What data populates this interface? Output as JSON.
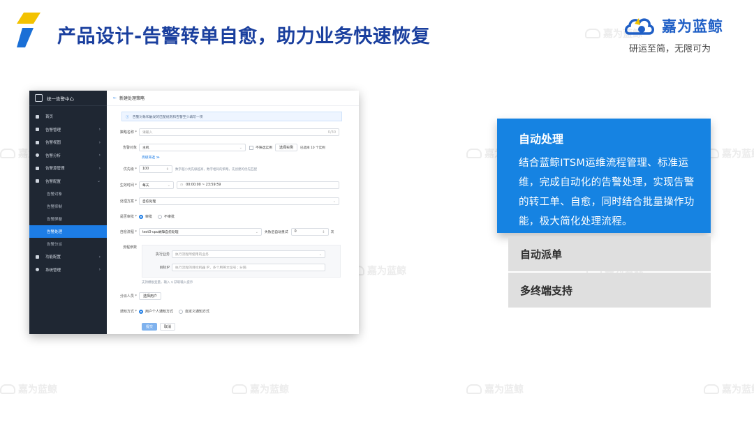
{
  "slide": {
    "title": "产品设计-告警转单自愈，助力业务快速恢复",
    "brand_name": "嘉为蓝鲸",
    "slogan": "研运至简，无限可为",
    "watermark": "嘉为蓝鲸"
  },
  "screenshot": {
    "sidebar": {
      "title": "统一告警中心",
      "items": [
        {
          "label": "首页",
          "arrow": ""
        },
        {
          "label": "告警管理",
          "arrow": "›"
        },
        {
          "label": "告警视图",
          "arrow": "›"
        },
        {
          "label": "告警分析",
          "arrow": "›"
        },
        {
          "label": "告警源管理",
          "arrow": "›"
        },
        {
          "label": "告警配置",
          "arrow": "⌄"
        }
      ],
      "subitems": [
        {
          "label": "告警对象"
        },
        {
          "label": "告警抑制"
        },
        {
          "label": "告警屏蔽"
        },
        {
          "label": "告警处理"
        },
        {
          "label": "告警分派"
        }
      ],
      "bottom_items": [
        {
          "label": "功能配置",
          "arrow": "›"
        },
        {
          "label": "系统管理",
          "arrow": "›"
        }
      ]
    },
    "header": {
      "back": "←",
      "title": "新建处理策略"
    },
    "tip": "告警对象和触发的匹配规则和告警至少填写一项",
    "form": {
      "name_label": "策略名称 *",
      "name_placeholder": "请输入",
      "name_counter": "0/30",
      "object_label": "告警对象",
      "object_value": "主机",
      "filter_instance": "不筛选实例",
      "select_instance": "选择实例",
      "selected_count": "已选择 10 个实例",
      "advanced": "高级筛选 ≫",
      "priority_label": "优先级 *",
      "priority_value": "100",
      "priority_hint": "数字越小优先级越高，数字相同的策略，先创建的优先匹配",
      "time_label": "生效时间 *",
      "time_value": "每天",
      "time_range": "00:00:00 ~ 23:59:59",
      "plan_label": "处理方案 *",
      "plan_value": "自愈处理",
      "audit_label": "是否审批 *",
      "audit_yes": "审批",
      "audit_no": "不审批",
      "flow_label": "自愈流程 *",
      "flow_value": "test3-cpu故障自愈处理",
      "retry_label": "失败后自动重试",
      "retry_value": "0",
      "retry_unit": "次",
      "params_label": "流程参数",
      "exec_label": "执行业务",
      "exec_placeholder": "执行流程所使用的业务",
      "target_label": "目标IP",
      "target_placeholder": "执行流程的目标机器 IP，多个用英文逗号 ; 分隔",
      "params_hint": "支持模板变量，输入 $ 获取输入提示",
      "assign_label": "分派人员 *",
      "assign_button": "选择用户",
      "notify_label": "通知方式 *",
      "notify_personal": "用户个人通知方式",
      "notify_custom": "自定义通知方式",
      "submit": "提交",
      "cancel": "取消"
    }
  },
  "panel": {
    "active_title": "自动处理",
    "active_body": "结合蓝鲸ITSM运维流程管理、标准运维，完成自动化的告警处理，实现告警的转工单、自愈，同时结合批量操作功能，极大简化处理流程。",
    "items": [
      "自动派单",
      "多终端支持"
    ]
  },
  "colors": {
    "title_blue": "#1a3f9e",
    "accent_blue": "#1683e2",
    "inactive_card": "#dfdfdf",
    "sidebar_bg": "#1f2733"
  }
}
